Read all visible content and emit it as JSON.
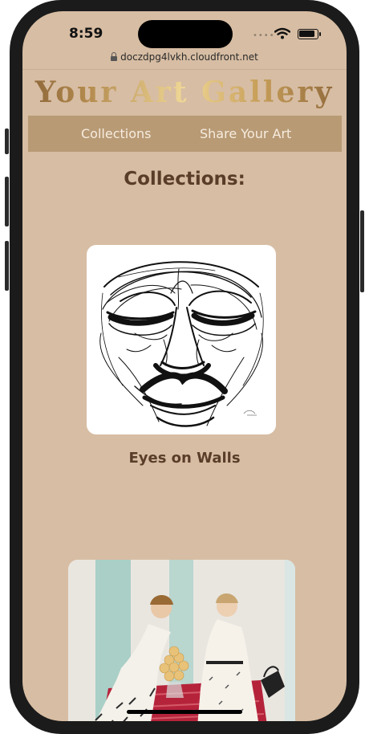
{
  "status_bar": {
    "time": "8:59",
    "dots": "••••"
  },
  "browser": {
    "url": "doczdpg4lvkh.cloudfront.net"
  },
  "site": {
    "title": "Your Art Gallery",
    "nav": {
      "collections": "Collections",
      "share": "Share Your Art"
    }
  },
  "collections": {
    "heading": "Collections:",
    "items": [
      {
        "caption": "Eyes on Walls"
      }
    ]
  },
  "colors": {
    "background": "#d7bda3",
    "navbar": "#b89a75",
    "heading": "#5a3d29"
  }
}
